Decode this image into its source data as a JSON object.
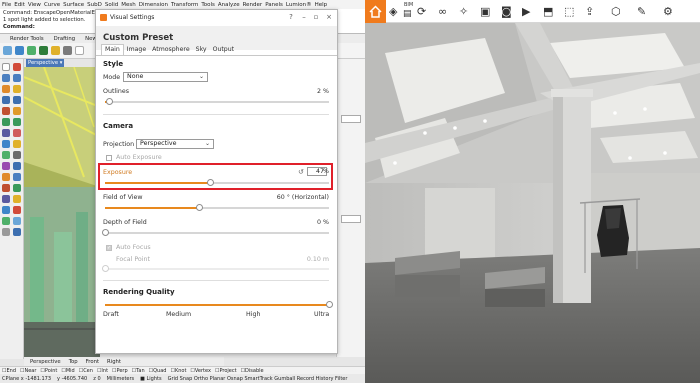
{
  "rhino": {
    "menu": [
      "File",
      "Edit",
      "View",
      "Curve",
      "Surface",
      "SubD",
      "Solid",
      "Mesh",
      "Dimension",
      "Transform",
      "Tools",
      "Analyze",
      "Render",
      "Panels",
      "Lumion®",
      "Help"
    ],
    "command_history": [
      "Command: EnscapeOpenMaterialEdi",
      "1 spot light added to selection.",
      "Command:"
    ],
    "toolbar_tabs": [
      "Render Tools",
      "Drafting",
      "New"
    ],
    "viewport_label": "Perspective",
    "viewport_tabs": [
      "Perspective",
      "Top",
      "Front",
      "Right"
    ],
    "osnaps": [
      "End",
      "Near",
      "Point",
      "Mid",
      "Cen",
      "Int",
      "Perp",
      "Tan",
      "Quad",
      "Knot",
      "Vertex",
      "Project",
      "Disable"
    ],
    "status_units": "Millimeters",
    "status_layer": "Lights",
    "status_cplane": "CPlane x -1481.173",
    "status_coords": "y -4605.740",
    "status_z": "z 0",
    "status_modes": "Grid Snap Ortho Planar Osnap SmartTrack Gumball Record History Filter"
  },
  "dialog": {
    "title": "Visual Settings",
    "preset_title": "Custom Preset",
    "tabs": [
      "Main",
      "Image",
      "Atmosphere",
      "Sky",
      "Output"
    ],
    "active_tab": "Main",
    "style": {
      "heading": "Style",
      "mode_label": "Mode",
      "mode_value": "None",
      "outlines_label": "Outlines",
      "outlines_value": "2 %",
      "outlines_level": 0.02
    },
    "camera": {
      "heading": "Camera",
      "projection_label": "Projection",
      "projection_value": "Perspective",
      "auto_exposure_label": "Auto Exposure",
      "auto_exposure_checked": false,
      "exposure_label": "Exposure",
      "exposure_value": "47",
      "exposure_unit": "%",
      "exposure_level": 0.47,
      "fov_label": "Field of View",
      "fov_value": "60 ° (Horizontal)",
      "fov_level": 0.42,
      "dof_label": "Depth of Field",
      "dof_value": "0 %",
      "dof_level": 0.0,
      "autofocus_label": "Auto Focus",
      "autofocus_checked": true,
      "focal_point_label": "Focal Point",
      "focal_point_value": "0.10 m"
    },
    "quality": {
      "heading": "Rendering Quality",
      "levels": [
        "Draft",
        "Medium",
        "High",
        "Ultra"
      ],
      "selected": "Ultra",
      "level": 1.0
    }
  },
  "enscape": {
    "toolbar": [
      {
        "icon": "home-icon",
        "label": ""
      },
      {
        "icon": "layers-icon",
        "label": ""
      },
      {
        "icon": "bim-icon",
        "label": "BIM"
      },
      {
        "icon": "sync-icon",
        "label": ""
      },
      {
        "icon": "walk-icon",
        "label": ""
      },
      {
        "icon": "compass-icon",
        "label": ""
      },
      {
        "icon": "clapper-icon",
        "label": ""
      },
      {
        "icon": "camera-icon",
        "label": ""
      },
      {
        "icon": "video-icon",
        "label": ""
      },
      {
        "icon": "panorama-icon",
        "label": ""
      },
      {
        "icon": "cube-icon",
        "label": ""
      },
      {
        "icon": "export-icon",
        "label": ""
      },
      {
        "icon": "assets-icon",
        "label": ""
      },
      {
        "icon": "pen-icon",
        "label": ""
      },
      {
        "icon": "settings-icon",
        "label": ""
      }
    ],
    "accent": "#f07b1d"
  },
  "colors": {
    "accent": "#e8891e",
    "highlight": "#e0202a"
  }
}
